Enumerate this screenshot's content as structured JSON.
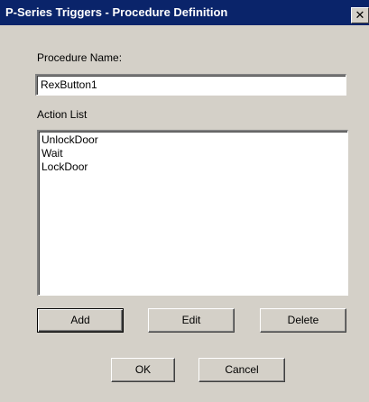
{
  "window": {
    "title": "P-Series Triggers - Procedure Definition",
    "close_glyph": "✕"
  },
  "procedure_name": {
    "label": "Procedure Name:",
    "value": "RexButton1"
  },
  "action_list": {
    "label": "Action List",
    "items": [
      "UnlockDoor",
      "Wait",
      "LockDoor"
    ]
  },
  "buttons": {
    "add": "Add",
    "edit": "Edit",
    "delete": "Delete",
    "ok": "OK",
    "cancel": "Cancel"
  }
}
